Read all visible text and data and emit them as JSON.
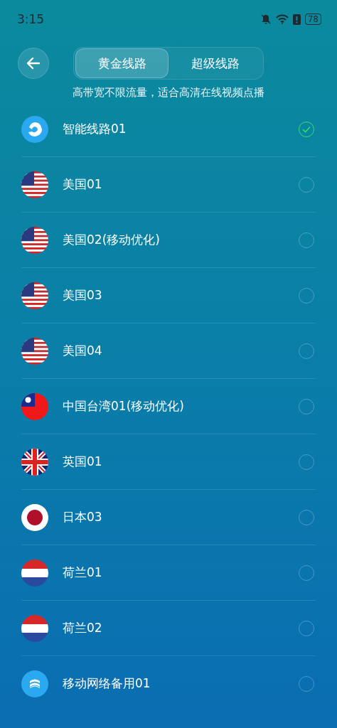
{
  "status_bar": {
    "time": "3:15",
    "battery": "78"
  },
  "header": {
    "tabs": [
      {
        "label": "黄金线路",
        "selected": true
      },
      {
        "label": "超级线路",
        "selected": false
      }
    ],
    "subtitle": "高带宽不限流量，适合高清在线视频点播"
  },
  "routes": [
    {
      "name": "智能线路01",
      "kind": "smart",
      "selected": true
    },
    {
      "name": "美国01",
      "kind": "us",
      "selected": false
    },
    {
      "name": "美国02(移动优化)",
      "kind": "us",
      "selected": false
    },
    {
      "name": "美国03",
      "kind": "us",
      "selected": false
    },
    {
      "name": "美国04",
      "kind": "us",
      "selected": false
    },
    {
      "name": "中国台湾01(移动优化)",
      "kind": "tw",
      "selected": false
    },
    {
      "name": "英国01",
      "kind": "uk",
      "selected": false
    },
    {
      "name": "日本03",
      "kind": "jp",
      "selected": false
    },
    {
      "name": "荷兰01",
      "kind": "nl",
      "selected": false
    },
    {
      "name": "荷兰02",
      "kind": "nl",
      "selected": false
    },
    {
      "name": "移动网络备用01",
      "kind": "mobile",
      "selected": false
    }
  ]
}
